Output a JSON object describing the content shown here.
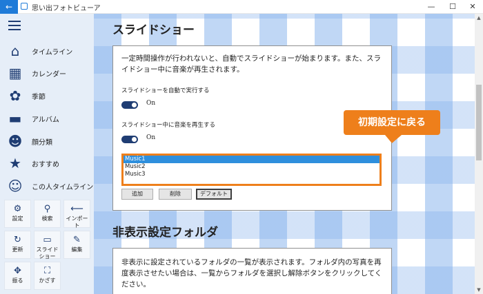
{
  "window": {
    "title": "思い出フォトビューア",
    "back_icon": "←",
    "minimize": "—",
    "maximize": "☐",
    "close": "✕"
  },
  "sidebar": {
    "items": [
      {
        "label": "タイムライン",
        "icon": "home-icon",
        "glyph": "⌂"
      },
      {
        "label": "カレンダー",
        "icon": "calendar-icon",
        "glyph": "▦"
      },
      {
        "label": "季節",
        "icon": "seasons-icon",
        "glyph": "✿"
      },
      {
        "label": "アルバム",
        "icon": "folder-icon",
        "glyph": "▬"
      },
      {
        "label": "顔分類",
        "icon": "faces-icon",
        "glyph": "☻"
      },
      {
        "label": "おすすめ",
        "icon": "star-icon",
        "glyph": "★"
      },
      {
        "label": "この人タイムライン",
        "icon": "person-timeline-icon",
        "glyph": "☺"
      }
    ],
    "tiles": [
      {
        "label": "設定",
        "icon": "gear-icon",
        "glyph": "⚙"
      },
      {
        "label": "検索",
        "icon": "search-icon",
        "glyph": "⚲"
      },
      {
        "label": "インポート",
        "icon": "import-icon",
        "glyph": "⟵"
      },
      {
        "label": "更新",
        "icon": "refresh-icon",
        "glyph": "↻"
      },
      {
        "label": "スライドショー",
        "icon": "slideshow-icon",
        "glyph": "▭"
      },
      {
        "label": "編集",
        "icon": "brush-icon",
        "glyph": "✎"
      },
      {
        "label": "振る",
        "icon": "shake-icon",
        "glyph": "✥"
      },
      {
        "label": "かざす",
        "icon": "frame-icon",
        "glyph": "⛶"
      }
    ]
  },
  "slideshow": {
    "title": "スライドショー",
    "description": "一定時間操作が行われないと、自動でスライドショーが始まります。また、スライドショー中に音楽が再生されます。",
    "auto_label": "スライドショーを自動で実行する",
    "auto_state": "On",
    "music_label": "スライドショー中に音楽を再生する",
    "music_state": "On",
    "music_items": [
      "Music1",
      "Music2",
      "Music3"
    ],
    "selected_item": "Music1",
    "buttons": {
      "add": "追加",
      "delete": "削除",
      "default": "デフォルト"
    },
    "callout": "初期設定に戻る",
    "callout_color": "#ee7f1b"
  },
  "hidden_folders": {
    "title": "非表示設定フォルダ",
    "description": "非表示に設定されているフォルダの一覧が表示されます。フォルダ内の写真を再度表示させたい場合は、一覧からフォルダを選択し解除ボタンをクリックしてください。"
  },
  "colors": {
    "accent": "#1f7bd8",
    "sidebar_bg": "#e6eef8",
    "selection": "#2e8fdd",
    "highlight": "#ee7f1b"
  }
}
